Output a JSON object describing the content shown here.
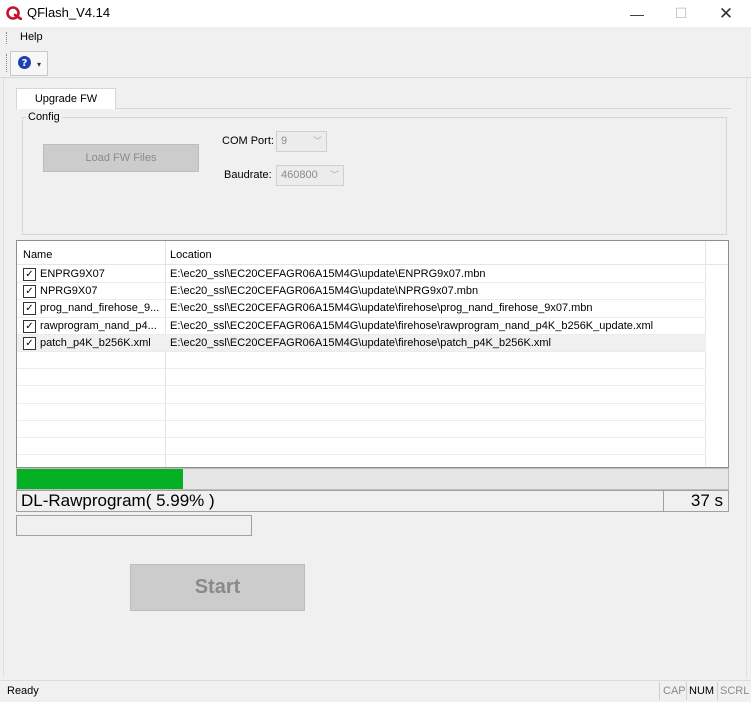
{
  "window": {
    "title": "QFlash_V4.14",
    "min_glyph": "—",
    "max_glyph": "☐",
    "close_glyph": "✕"
  },
  "menu": {
    "help": "Help"
  },
  "toolbar": {
    "help_icon": "help-question-icon",
    "dropdown_glyph": "▾"
  },
  "tabs": [
    {
      "label": "Upgrade FW"
    }
  ],
  "config": {
    "legend": "Config",
    "load_fw_label": "Load FW Files",
    "com_port_label": "COM Port:",
    "com_port_value": "9",
    "baudrate_label": "Baudrate:",
    "baudrate_value": "460800"
  },
  "file_list": {
    "columns": [
      "Name",
      "Location"
    ],
    "rows": [
      {
        "checked": true,
        "name": "ENPRG9X07",
        "location": "E:\\ec20_ssl\\EC20CEFAGR06A15M4G\\update\\ENPRG9x07.mbn"
      },
      {
        "checked": true,
        "name": "NPRG9X07",
        "location": "E:\\ec20_ssl\\EC20CEFAGR06A15M4G\\update\\NPRG9x07.mbn"
      },
      {
        "checked": true,
        "name": "prog_nand_firehose_9...",
        "location": "E:\\ec20_ssl\\EC20CEFAGR06A15M4G\\update\\firehose\\prog_nand_firehose_9x07.mbn"
      },
      {
        "checked": true,
        "name": "rawprogram_nand_p4...",
        "location": "E:\\ec20_ssl\\EC20CEFAGR06A15M4G\\update\\firehose\\rawprogram_nand_p4K_b256K_update.xml"
      },
      {
        "checked": true,
        "name": "patch_p4K_b256K.xml",
        "location": "E:\\ec20_ssl\\EC20CEFAGR06A15M4G\\update\\firehose\\patch_p4K_b256K.xml"
      }
    ]
  },
  "progress": {
    "fraction": 0.233,
    "status_text": "DL-Rawprogram( 5.99% )",
    "elapsed": "37 s"
  },
  "start_label": "Start",
  "statusbar": {
    "ready": "Ready",
    "cap": "CAP",
    "num": "NUM",
    "scrl": "SCRL"
  },
  "colors": {
    "progress_fill": "#06b025",
    "logo_red": "#c8102e"
  }
}
